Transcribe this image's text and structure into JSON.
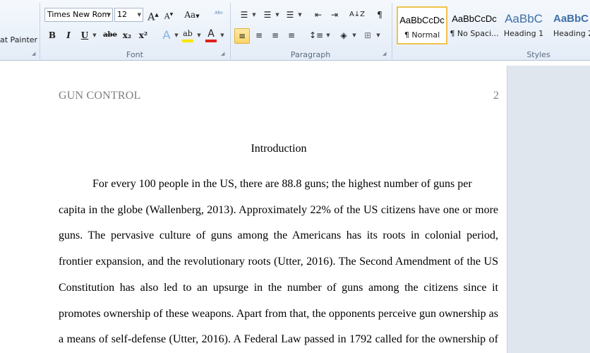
{
  "ribbon": {
    "clipboard": {
      "format_painter_label": "at Painter"
    },
    "font": {
      "group_label": "Font",
      "font_name": "Times New Rom",
      "font_size": "12",
      "grow_font": "A",
      "shrink_font": "A",
      "change_case": "Aa",
      "clear_formatting": "ᴬᵇᶜ",
      "bold": "B",
      "italic": "I",
      "underline": "U",
      "strikethrough": "abe",
      "subscript": "x₂",
      "superscript": "x²",
      "text_effects": "A",
      "highlight": "ab",
      "font_color": "A",
      "highlight_color": "#f6e600",
      "font_color_value": "#e0211b"
    },
    "paragraph": {
      "group_label": "Paragraph",
      "bullets": "☰",
      "numbering": "☰",
      "multilevel": "☰",
      "decrease_indent": "⇤",
      "increase_indent": "⇥",
      "sort": "A↓Z",
      "show_marks": "¶",
      "align_left": "≡",
      "center": "≡",
      "align_right": "≡",
      "justify": "≡",
      "line_spacing": "↕≡",
      "shading": "◈",
      "borders": "⊞"
    },
    "styles": {
      "group_label": "Styles",
      "items": [
        {
          "sample": "AaBbCcDc",
          "name": "¶ Normal",
          "selected": true
        },
        {
          "sample": "AaBbCcDc",
          "name": "¶ No Spaci...",
          "selected": false
        },
        {
          "sample": "AaBbC",
          "name": "Heading 1",
          "selected": false
        },
        {
          "sample": "AaBbC",
          "name": "Heading 2",
          "selected": false
        }
      ]
    }
  },
  "document": {
    "running_head": "GUN CONTROL",
    "page_number": "2",
    "heading": "Introduction",
    "lines": [
      "For every 100 people in the US, there are 88.8 guns; the highest number of guns per",
      "capita in the globe (Wallenberg, 2013). Approximately 22% of the US citizens have one or more",
      "guns. The pervasive culture of guns among the Americans has its roots in colonial period,",
      "frontier expansion, and the revolutionary roots (Utter, 2016). The Second Amendment of the US",
      "Constitution has also led to an upsurge in the number of guns among the citizens since it",
      "promotes ownership of these weapons. Apart from that, the opponents perceive gun ownership as",
      "a means of self-defense (Utter, 2016). A Federal Law passed in 1792 called for the ownership of"
    ]
  }
}
